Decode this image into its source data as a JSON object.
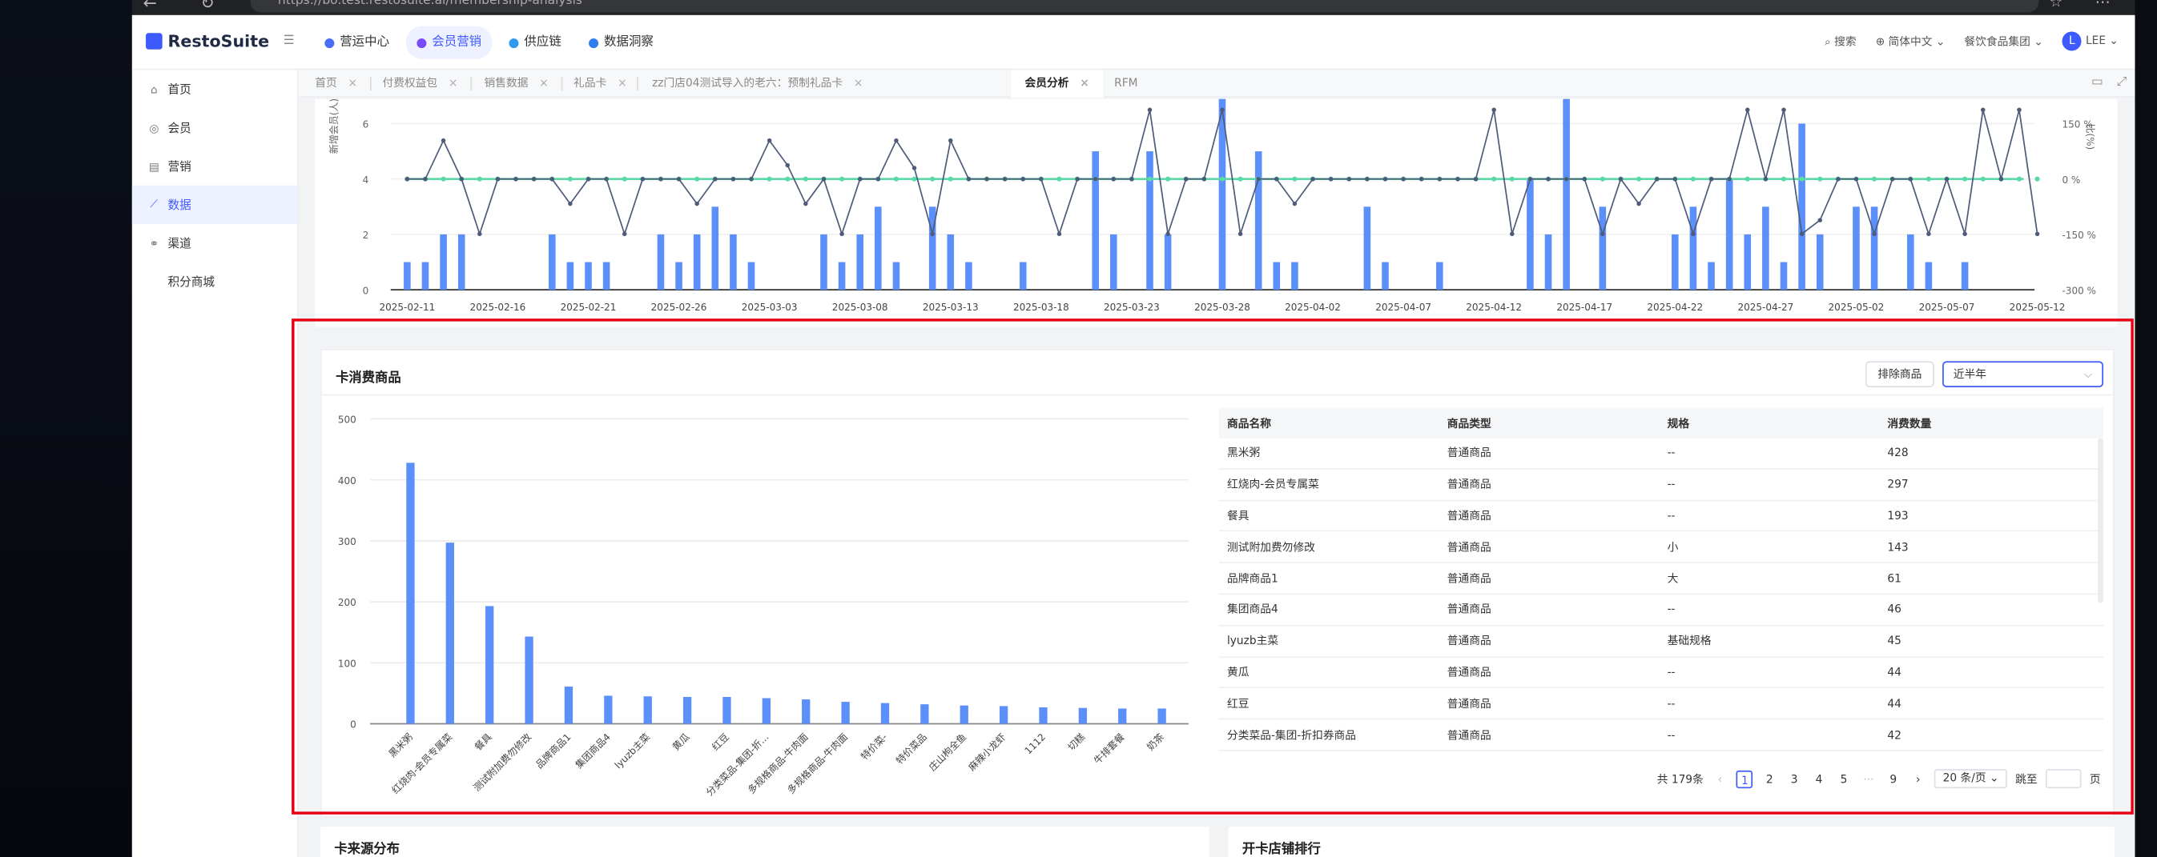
{
  "browser": {
    "url": "https://bo.test.restosuite.ai/membership-analysis",
    "nav_icons": "← ↻ ⌂",
    "right_icons": "☆ ⋯"
  },
  "app": {
    "logo": "RestoSuite",
    "collapse_icon": "☰",
    "top_menu": [
      {
        "label": "营运中心",
        "color": "#4a6cf7"
      },
      {
        "label": "会员营销",
        "color": "#7b4bf7"
      },
      {
        "label": "供应链",
        "color": "#2f9bf0"
      },
      {
        "label": "数据洞察",
        "color": "#2f7df0"
      }
    ],
    "search": "搜索",
    "language": "简体中文",
    "company": "餐饮食品集团",
    "avatar_letter": "L",
    "user": "LEE"
  },
  "sidebar": {
    "items": [
      {
        "label": "首页",
        "icon": "home-icon",
        "glyph": "⌂"
      },
      {
        "label": "会员",
        "icon": "member-icon",
        "glyph": "◎"
      },
      {
        "label": "营销",
        "icon": "marketing-icon",
        "glyph": "▤"
      },
      {
        "label": "数据",
        "icon": "chart-icon",
        "glyph": "⟋"
      },
      {
        "label": "渠道",
        "icon": "channel-icon",
        "glyph": "⚭"
      },
      {
        "label": "积分商城",
        "icon": "",
        "glyph": ""
      }
    ]
  },
  "tabs": [
    {
      "label": "首页",
      "closable": true
    },
    {
      "label": "付费权益包",
      "closable": true
    },
    {
      "label": "销售数据",
      "closable": true
    },
    {
      "label": "礼品卡",
      "closable": true
    },
    {
      "label": "zz门店04测试导入的老六：预制礼品卡",
      "closable": true
    },
    {
      "label": "会员分析",
      "closable": true
    },
    {
      "label": "RFM",
      "closable": false
    }
  ],
  "tab_close": "×",
  "top_chart": {
    "y_left_label": "新增会员(人)",
    "y_right_label": "比(%)",
    "y_ticks_left": [
      "6",
      "4",
      "2",
      "0"
    ],
    "y_ticks_right": [
      "150 %",
      "0 %",
      "-150 %",
      "-300 %"
    ],
    "x_ticks": [
      "2025-02-11",
      "2025-02-16",
      "2025-02-21",
      "2025-02-26",
      "2025-03-03",
      "2025-03-08",
      "2025-03-13",
      "2025-03-18",
      "2025-03-23",
      "2025-03-28",
      "2025-04-02",
      "2025-04-07",
      "2025-04-12",
      "2025-04-17",
      "2025-04-22",
      "2025-04-27",
      "2025-05-02",
      "2025-05-07",
      "2025-05-12"
    ],
    "colors": {
      "bar": "#5b8ff9",
      "line": "#4e5b7a",
      "flat": "#5ad8a6"
    }
  },
  "card": {
    "title": "卡消费商品",
    "exclude_button": "排除商品",
    "range_select": "近半年",
    "dropdown_icon": "⌵"
  },
  "chart_data": {
    "type": "bar",
    "title": "",
    "categories": [
      "黑米粥",
      "红烧肉-会员专属菜",
      "餐具",
      "测试附加费勿修改",
      "品牌商品1",
      "集团商品4",
      "lyuzb主菜",
      "黄瓜",
      "红豆",
      "分类菜品-集团-折...",
      "多规格商品-牛肉面",
      "多规格商品-牛肉面",
      "特价菜-",
      "特价菜品",
      "庄山枸全鱼",
      "麻辣小龙虾",
      "1112",
      "切糕",
      "牛排套餐",
      "奶茶"
    ],
    "values": [
      428,
      297,
      193,
      143,
      61,
      46,
      45,
      44,
      44,
      42,
      40,
      36,
      34,
      32,
      30,
      29,
      27,
      26,
      25,
      25
    ],
    "ylim": [
      0,
      500
    ],
    "y_ticks": [
      0,
      100,
      200,
      300,
      400,
      500
    ],
    "color": "#5b8ff9",
    "grid": true
  },
  "table": {
    "headers": [
      "商品名称",
      "商品类型",
      "规格",
      "消费数量"
    ],
    "rows": [
      [
        "黑米粥",
        "普通商品",
        "--",
        "428"
      ],
      [
        "红烧肉-会员专属菜",
        "普通商品",
        "--",
        "297"
      ],
      [
        "餐具",
        "普通商品",
        "--",
        "193"
      ],
      [
        "测试附加费勿修改",
        "普通商品",
        "小",
        "143"
      ],
      [
        "品牌商品1",
        "普通商品",
        "大",
        "61"
      ],
      [
        "集团商品4",
        "普通商品",
        "--",
        "46"
      ],
      [
        "lyuzb主菜",
        "普通商品",
        "基础规格",
        "45"
      ],
      [
        "黄瓜",
        "普通商品",
        "--",
        "44"
      ],
      [
        "红豆",
        "普通商品",
        "--",
        "44"
      ],
      [
        "分类菜品-集团-折扣券商品",
        "普通商品",
        "--",
        "42"
      ]
    ]
  },
  "pagination": {
    "total": "共 179条",
    "prev": "‹",
    "pages": [
      "1",
      "2",
      "3",
      "4",
      "5"
    ],
    "ellipsis": "···",
    "last": "9",
    "next": "›",
    "page_size": "20 条/页",
    "jump_label": "跳至",
    "page_unit": "页"
  },
  "bottom": {
    "left_title": "卡来源分布",
    "right_title": "开卡店铺排行"
  }
}
